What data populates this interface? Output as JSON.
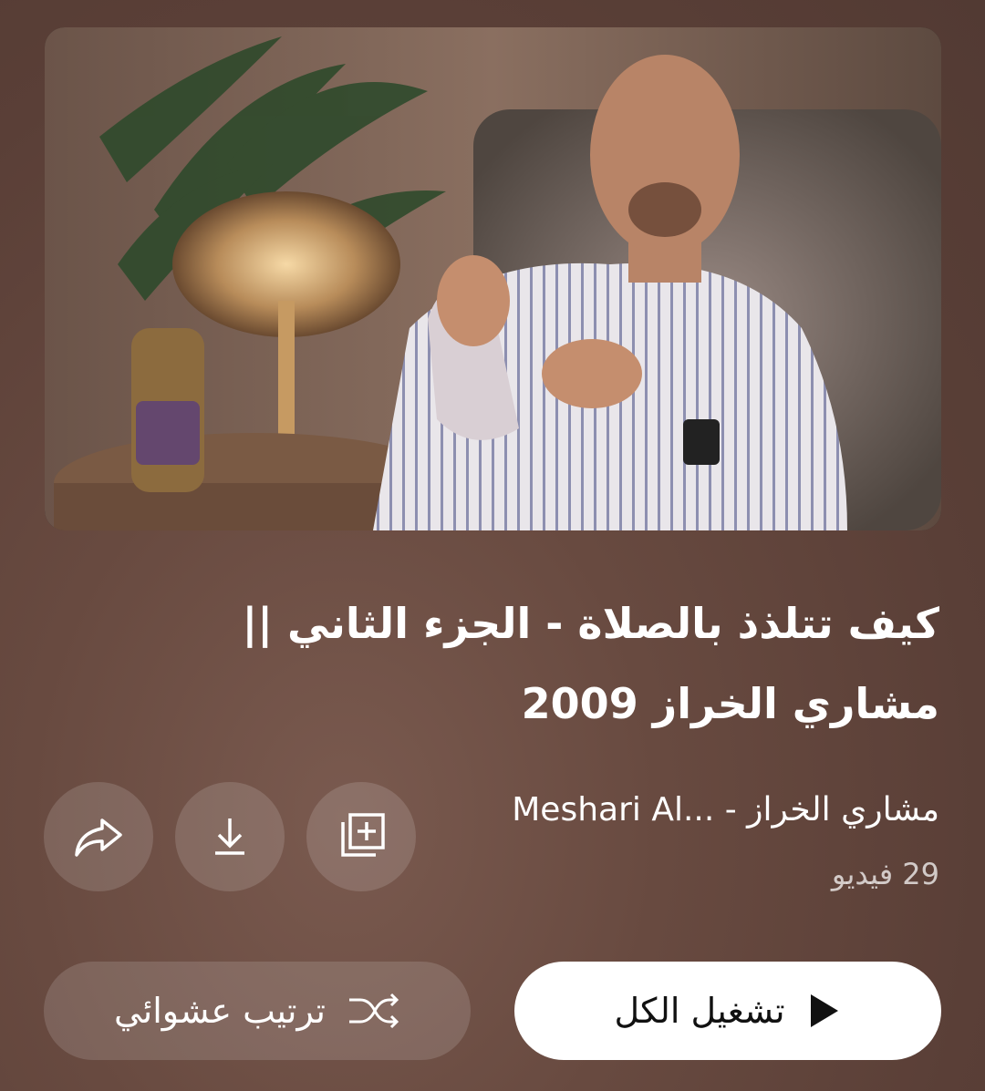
{
  "playlist": {
    "title_line1": "كيف تتلذذ بالصلاة - الجزء الثاني ||",
    "title_line2": "مشاري الخراز 2009",
    "channel": "مشاري الخراز - ...Meshari Al",
    "video_count": "29 فيديو"
  },
  "actions": {
    "share_icon": "share-arrow",
    "download_icon": "download-arrow",
    "save_icon": "add-to-library"
  },
  "buttons": {
    "play_all_label": "تشغيل الكل",
    "shuffle_label": "ترتيب عشوائي"
  },
  "colors": {
    "background": "#5e4239",
    "button_bg": "rgba(255,255,255,0.14)",
    "play_button_bg": "#ffffff",
    "play_button_text": "#111111"
  }
}
